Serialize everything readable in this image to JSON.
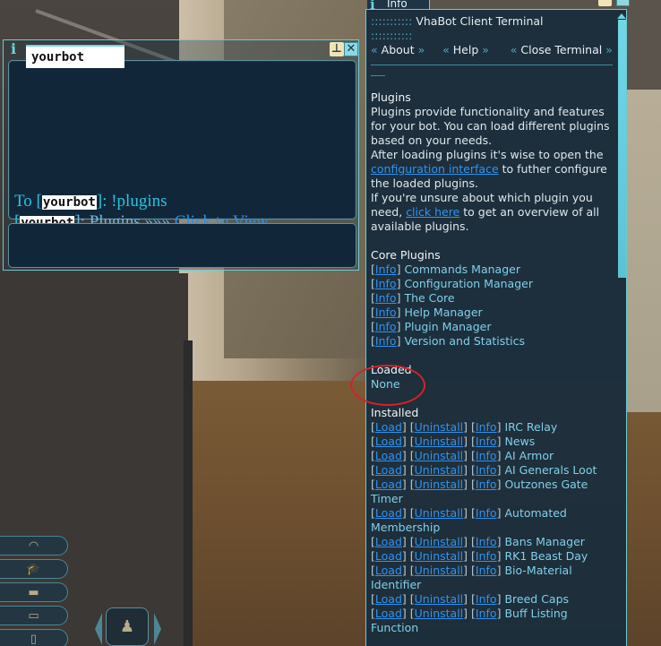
{
  "chat_window": {
    "title": "yourbot",
    "pin_icon": "pin-icon",
    "close_icon": "close-icon",
    "messages": [
      {
        "prefix": "To [",
        "name": "yourbot",
        "suffix": "]: !plugins"
      },
      {
        "prefix": "[",
        "name": "yourbot",
        "mid": "]: Plugins »»» ",
        "link": "Click to View"
      }
    ]
  },
  "info_window": {
    "tab_label": "Info",
    "header_dots": ":::::::::::",
    "header_title": "VhaBot Client Terminal",
    "nav": [
      {
        "label": "About"
      },
      {
        "label": "Help"
      },
      {
        "label": "Close Terminal"
      }
    ],
    "plugins_section": {
      "heading": "Plugins",
      "para1": "Plugins provide functionality and features for your bot. You can load different plugins based on your needs.",
      "para2_before": "After loading plugins it's wise to open the ",
      "para2_link": "configuration interface",
      "para2_after": " to futher configure the loaded plugins.",
      "para3_before": "If you're unsure about which plugin you need, ",
      "para3_link": "click here",
      "para3_after": " to get an overview of all available plugins."
    },
    "core_plugins": {
      "heading": "Core Plugins",
      "info_label": "Info",
      "items": [
        "Commands Manager",
        "Configuration Manager",
        "The Core",
        "Help Manager",
        "Plugin Manager",
        "Version and Statistics"
      ]
    },
    "loaded": {
      "heading": "Loaded",
      "value": "None"
    },
    "installed": {
      "heading": "Installed",
      "load_label": "Load",
      "uninstall_label": "Uninstall",
      "info_label": "Info",
      "items": [
        "IRC Relay",
        "News",
        "AI Armor",
        "AI Generals Loot",
        "Outzones Gate Timer",
        "Automated Membership",
        "Bans Manager",
        "RK1 Beast Day",
        "Bio-Material Identifier",
        "Breed Caps",
        "Buff Listing Function"
      ]
    }
  },
  "hud": {
    "buttons": [
      "radar-icon",
      "graduation-cap-icon",
      "armor-icon",
      "bag-icon",
      "backpack-icon"
    ],
    "character_frame": "character-icon"
  },
  "colors": {
    "window_border": "#6fc9d2",
    "link": "#2f93f0",
    "plugin_name": "#7fd0ea",
    "annotation_circle": "#d6222a"
  }
}
